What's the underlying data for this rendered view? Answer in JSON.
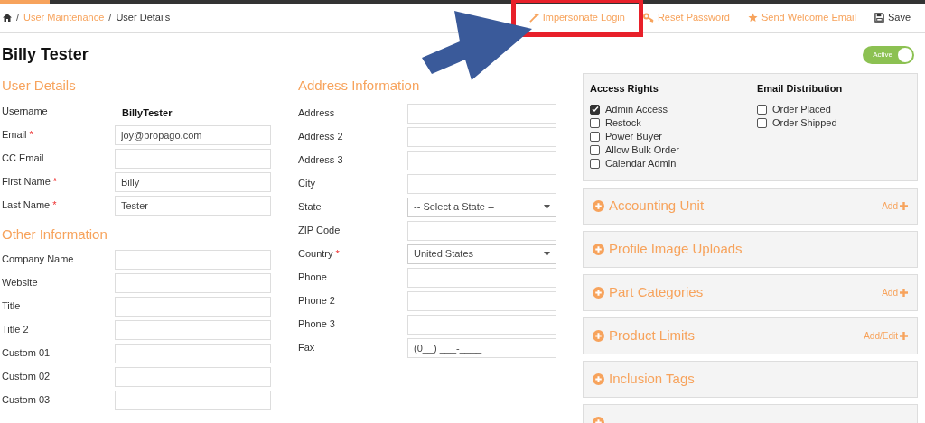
{
  "breadcrumb": [
    {
      "separator": "/",
      "label": "User Maintenance",
      "link": true
    },
    {
      "separator": "/",
      "label": "User Details",
      "link": false
    }
  ],
  "required_mark": "*",
  "actions": [
    {
      "kind": "wand",
      "label": "Impersonate Login",
      "highlighted": true
    },
    {
      "kind": "key",
      "label": "Reset Password",
      "highlighted": false
    },
    {
      "kind": "star",
      "label": "Send Welcome Email",
      "highlighted": false
    },
    {
      "kind": "save",
      "label": "Save",
      "highlighted": false
    }
  ],
  "title": "Billy Tester",
  "status_toggle": {
    "label": "Active",
    "on": true
  },
  "user_details": {
    "heading": "User Details",
    "fields": [
      {
        "label": "Username",
        "kind": "static",
        "value": "BillyTester",
        "required": false
      },
      {
        "label": "Email",
        "kind": "text",
        "value": "joy@propago.com",
        "required": true
      },
      {
        "label": "CC Email",
        "kind": "text",
        "required": false
      },
      {
        "label": "First Name",
        "kind": "text",
        "value": "Billy",
        "required": true
      },
      {
        "label": "Last Name",
        "kind": "text",
        "value": "Tester",
        "required": true
      }
    ]
  },
  "other_information": {
    "heading": "Other Information",
    "fields": [
      {
        "label": "Company Name",
        "kind": "text",
        "required": false
      },
      {
        "label": "Website",
        "kind": "text",
        "required": false
      },
      {
        "label": "Title",
        "kind": "text",
        "required": false
      },
      {
        "label": "Title 2",
        "kind": "text",
        "required": false
      },
      {
        "label": "Custom 01",
        "kind": "text",
        "required": false
      },
      {
        "label": "Custom 02",
        "kind": "text",
        "required": false
      },
      {
        "label": "Custom 03",
        "kind": "text",
        "required": false
      }
    ]
  },
  "address_information": {
    "heading": "Address Information",
    "fields": [
      {
        "label": "Address",
        "kind": "text",
        "required": false
      },
      {
        "label": "Address 2",
        "kind": "text",
        "required": false
      },
      {
        "label": "Address 3",
        "kind": "text",
        "required": false
      },
      {
        "label": "City",
        "kind": "text",
        "required": false
      },
      {
        "label": "State",
        "kind": "select",
        "value": "-- Select a State --",
        "required": false
      },
      {
        "label": "ZIP Code",
        "kind": "text",
        "required": false
      },
      {
        "label": "Country",
        "kind": "select",
        "value": "United States",
        "required": true
      },
      {
        "label": "Phone",
        "kind": "text",
        "required": false
      },
      {
        "label": "Phone 2",
        "kind": "text",
        "required": false
      },
      {
        "label": "Phone 3",
        "kind": "text",
        "required": false
      },
      {
        "label": "Fax",
        "kind": "text",
        "value": "(0__) ___-____",
        "required": false
      }
    ]
  },
  "access_rights": {
    "heading": "Access Rights",
    "items": [
      {
        "label": "Admin Access",
        "checked": true
      },
      {
        "label": "Restock",
        "checked": false
      },
      {
        "label": "Power Buyer",
        "checked": false
      },
      {
        "label": "Allow Bulk Order",
        "checked": false
      },
      {
        "label": "Calendar Admin",
        "checked": false
      }
    ]
  },
  "email_distribution": {
    "heading": "Email Distribution",
    "items": [
      {
        "label": "Order Placed",
        "checked": false
      },
      {
        "label": "Order Shipped",
        "checked": false
      }
    ]
  },
  "panels": [
    {
      "title": "Accounting Unit",
      "action": "Add"
    },
    {
      "title": "Profile Image Uploads"
    },
    {
      "title": "Part Categories",
      "action": "Add"
    },
    {
      "title": "Product Limits",
      "action": "Add/Edit"
    },
    {
      "title": "Inclusion Tags"
    }
  ],
  "more_panels_below": true
}
